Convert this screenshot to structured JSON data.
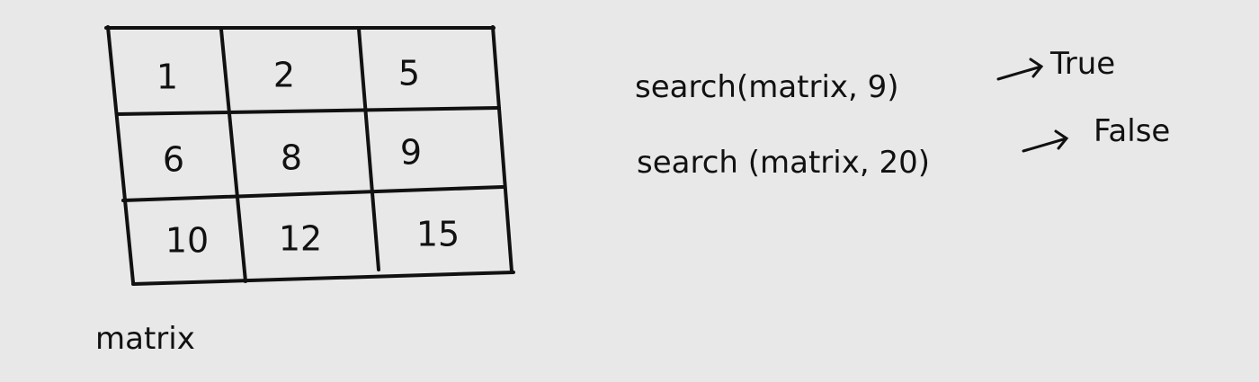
{
  "matrix": {
    "label": "matrix",
    "rows": [
      [
        "1",
        "2",
        "5"
      ],
      [
        "6",
        "8",
        "9"
      ],
      [
        "10",
        "12",
        "15"
      ]
    ]
  },
  "examples": [
    {
      "call": "search(matrix, 9)",
      "result": "True"
    },
    {
      "call": "search (matrix, 20)",
      "result": "False"
    }
  ],
  "colors": {
    "background": "#e8e8e8",
    "ink": "#111111"
  }
}
